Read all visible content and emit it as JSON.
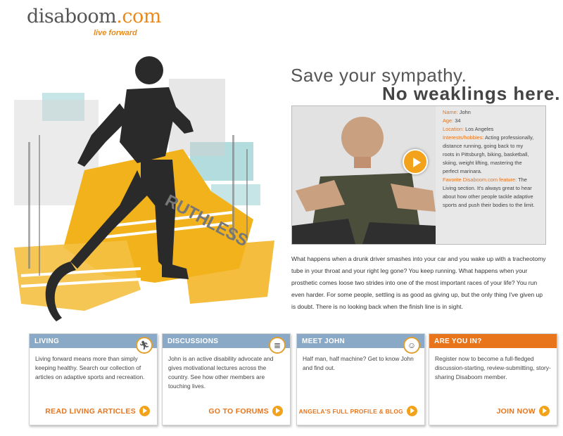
{
  "logo": {
    "brand": "disaboom",
    "domain": ".com",
    "tagline": "live forward"
  },
  "hero": {
    "graffiti_text": "RUTHLESS"
  },
  "headline": {
    "line1": "Save your sympathy.",
    "line2": "No weaklings here."
  },
  "profile": {
    "name_label": "Name:",
    "name": "John",
    "age_label": "Age:",
    "age": "34",
    "location_label": "Location:",
    "location": "Los Angeles",
    "interests_label": "Interests/hobbies:",
    "interests": "Acting professionally, distance running, going back to my roots in Pittsburgh, biking, basketball, skiing, weight lifting, mastering the perfect marinara.",
    "feature_label": "Favorite Disaboom.com feature:",
    "feature": "The Living section. It's always great to hear about how other people tackle adaptive sports and push their bodies to the limit."
  },
  "story": "What happens when a drunk driver smashes into your car and you wake up with a tracheotomy tube in your throat and your right leg gone? You keep running. What happens when your prosthetic comes loose two strides into one of the most important races of your life? You run even harder. For some people, settling is as good as giving up, but the only thing I've given up is doubt. There is no looking back when the finish line is in sight.",
  "cards": [
    {
      "title": "LIVING",
      "icon": "runner-icon",
      "body": "Living forward means more than simply keeping healthy. Search our collection of articles on adaptive sports and recreation.",
      "link": "READ LIVING ARTICLES"
    },
    {
      "title": "DISCUSSIONS",
      "icon": "notepad-icon",
      "body": "John is an active disability advocate and gives motivational lectures across the country. See how other members are touching lives.",
      "link": "GO TO FORUMS"
    },
    {
      "title": "MEET JOHN",
      "icon": "people-icon",
      "body": "Half man, half machine? Get to know John and find out.",
      "link": "ANGELA'S FULL PROFILE & BLOG"
    },
    {
      "title": "ARE YOU IN?",
      "body": "Register now to become a full-fledged discussion-starting, review-submitting, story-sharing Disaboom member.",
      "link": "JOIN NOW"
    }
  ],
  "colors": {
    "accent": "#e8741b",
    "card_header": "#8aa9c6",
    "hero_yellow": "#f2b21b",
    "hero_teal": "#8fcad0"
  }
}
